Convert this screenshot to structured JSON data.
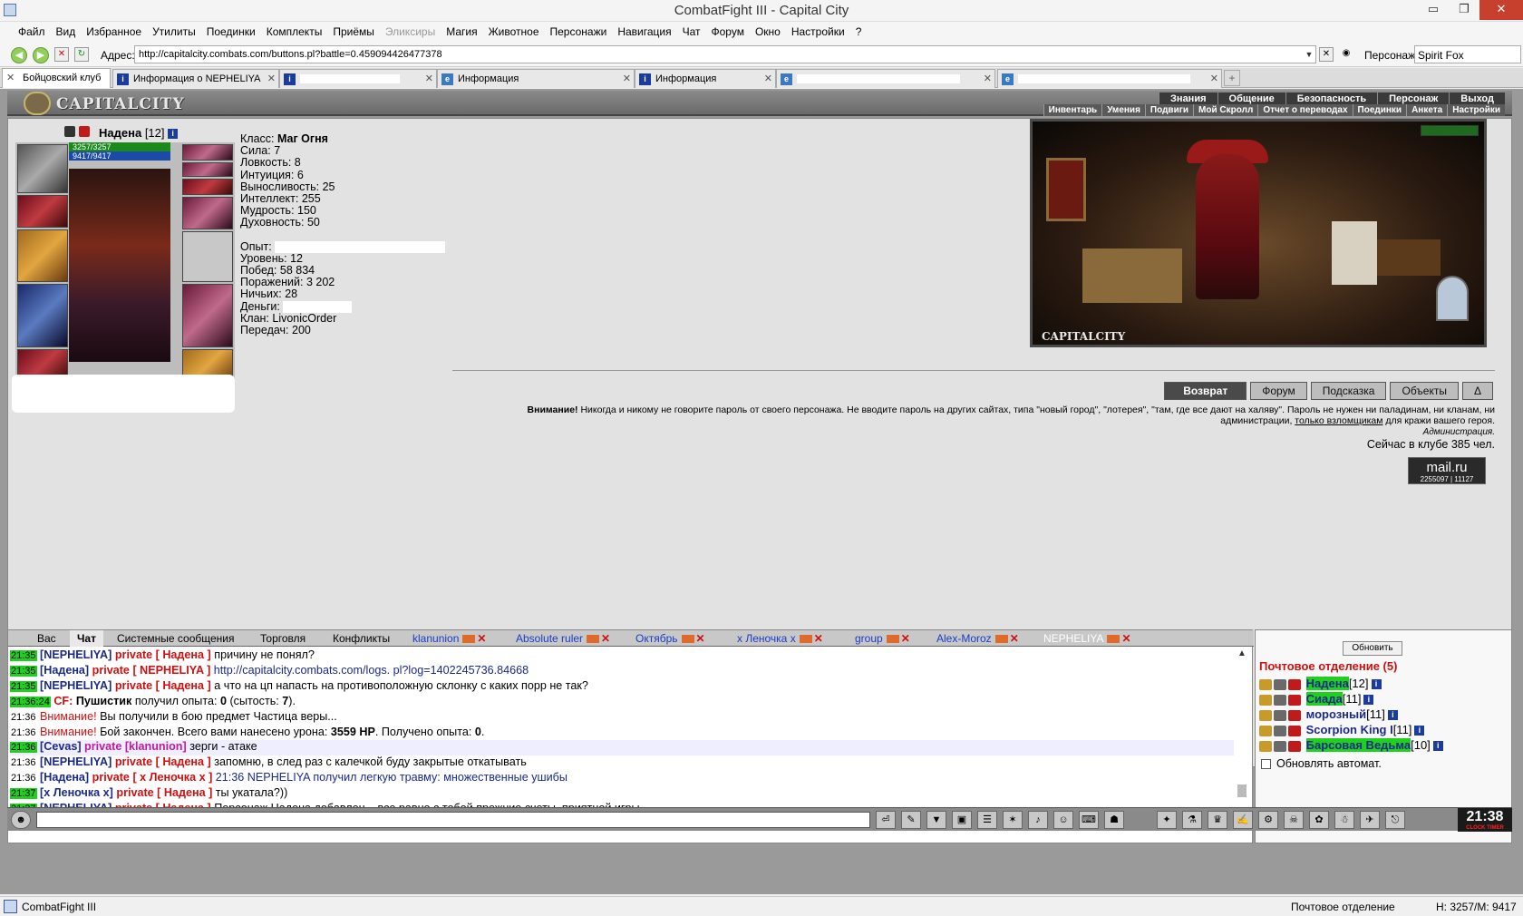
{
  "window": {
    "title": "CombatFight III - Capital City",
    "buttons": [
      "▭",
      "❐",
      "✕"
    ]
  },
  "menu": [
    "Файл",
    "Вид",
    "Избранное",
    "Утилиты",
    "Поединки",
    "Комплекты",
    "Приёмы",
    "Эликсиры",
    "Магия",
    "Животное",
    "Персонажи",
    "Навигация",
    "Чат",
    "Форум",
    "Окно",
    "Настройки",
    "?"
  ],
  "address": {
    "label": "Адрес:",
    "url": "http://capitalcity.combats.com/buttons.pl?battle=0.459094426477378"
  },
  "persona": {
    "label": "Персонаж:",
    "value": "Spirit Fox"
  },
  "tabs": [
    {
      "label": "Бойцовский клуб"
    },
    {
      "label": "Информация о NEPHELIYA"
    },
    {
      "label": ""
    },
    {
      "label": "Информация"
    },
    {
      "label": "Информация"
    },
    {
      "label": ""
    },
    {
      "label": ""
    }
  ],
  "game": {
    "logo": "CAPITALCITY",
    "nav_top": [
      "Знания",
      "Общение",
      "Безопасность",
      "Персонаж",
      "Выход"
    ],
    "nav_sub": [
      "Инвентарь",
      "Умения",
      "Подвиги",
      "Мой Скролл",
      "Отчет о переводах",
      "Поединки",
      "Анкета",
      "Настройки"
    ]
  },
  "character": {
    "name": "Надена",
    "level": "[12]",
    "hp": "3257/3257",
    "mp": "9417/9417",
    "stats": [
      {
        "label": "Класс: ",
        "value": "Маг Огня",
        "bold": true
      },
      {
        "label": "Сила: 7"
      },
      {
        "label": "Ловкость: 8"
      },
      {
        "label": "Интуиция: 6"
      },
      {
        "label": "Выносливость: 25"
      },
      {
        "label": "Интеллект: 255"
      },
      {
        "label": "Мудрость: 150"
      },
      {
        "label": "Духовность: 50"
      }
    ],
    "stats2": [
      "Опыт:",
      "Уровень: 12",
      "Побед: 58 834",
      "Поражений: 3 202",
      "Ничьих: 28",
      "Деньги:",
      "Клан: LivonicOrder",
      "Передач: 200"
    ]
  },
  "scene": {
    "caption": "CAPITALCITY"
  },
  "actions": [
    "Возврат",
    "Форум",
    "Подсказка",
    "Объекты",
    "Δ"
  ],
  "warning": {
    "bold": "Внимание!",
    "text": " Никогда и никому не говорите пароль от своего персонажа. Не вводите пароль на других сайтах, типа \"новый город\", \"лотерея\", \"там, где все дают на халяву\". Пароль не нужен ни паладинам, ни кланам, ни администрации, ",
    "link": "только взломщикам",
    "tail": " для кражи вашего героя."
  },
  "admin": "Администрация.",
  "online": "Сейчас в клубе 385 чел.",
  "mailru": {
    "brand": "mail.ru",
    "counts": "2255097 | 11127"
  },
  "chat_tabs": [
    "Вас",
    "Чат",
    "Системные сообщения",
    "Торговля",
    "Конфликты",
    "klanunion",
    "Absolute ruler",
    "Октябрь",
    "x Леночка x",
    "group",
    "Alex-Moroz",
    "NEPHELIYA"
  ],
  "chat": [
    {
      "t": "21:35",
      "who": "[NEPHELIYA]",
      "pv": "private [ Надена ]",
      "msg": "причину не понял?"
    },
    {
      "t": "21:35",
      "who": "[Надена]",
      "pv": "private [ NEPHELIYA ]",
      "msg": "http://capitalcity.combats.com/logs. pl?log=1402245736.84668"
    },
    {
      "t": "21:35",
      "who": "[NEPHELIYA]",
      "pv": "private [ Надена ]",
      "msg": "а что на цп напасть на противоположную склонку с каких порр не так?"
    },
    {
      "t": "21:36:24",
      "cf": "CF:",
      "b1": "Пушистик",
      "msg": " получил опыта: ",
      "n1": "0",
      "m2": " (сытость: ",
      "n2": "7",
      "m3": ")."
    },
    {
      "t": "21:36",
      "warn": "Внимание!",
      "msg": " Вы получили в бою предмет Частица веры..."
    },
    {
      "t": "21:36",
      "warn": "Внимание!",
      "msg": " Бой закончен. Всего вами нанесено урона: ",
      "n1": "3559 HP",
      "m2": ". Получено опыта: ",
      "n2": "0",
      "m3": "."
    },
    {
      "t": "21:36",
      "who": "[Cevas]",
      "pvp": "private [klanunion]",
      "msg": "зерги - атаке",
      "sel": true
    },
    {
      "t": "21:36",
      "who": "[NEPHELIYA]",
      "pv": "private [ Надена ]",
      "msg": "запомню, в след раз с калечкой буду закрытые откатывать"
    },
    {
      "t": "21:36",
      "who": "[Надена]",
      "pv": "private [ x Леночка x ]",
      "msgb": "21:36 NEPHELIYA получил легкую травму: множественные ушибы"
    },
    {
      "t": "21:37",
      "who": "[x Леночка x]",
      "pv": "private [ Надена ]",
      "msg": "ты укатала?))"
    },
    {
      "t": "21:37",
      "who": "[NEPHELIYA]",
      "pv": "private [ Надена ]",
      "msg": "Персонаж Надена добавлен. , все равно с тобой прежние счеты, приятной игры"
    }
  ],
  "mail": {
    "refresh": "Обновить",
    "title": "Почтовое отделение (5)",
    "users": [
      {
        "name": "Надена",
        "level": "[12]",
        "hl": true
      },
      {
        "name": "Сиада",
        "level": "[11]",
        "hl": true
      },
      {
        "name": "морозный",
        "level": "[11]",
        "hl": false
      },
      {
        "name": "Scorpion King I",
        "level": "[11]",
        "hl": false
      },
      {
        "name": "Барсовая Ведьма",
        "level": "[10]",
        "hl": true
      }
    ],
    "auto": "Обновлять автомат."
  },
  "clock": {
    "time": "21:38",
    "sub": "CLOCK TIMER"
  },
  "status": {
    "left": "CombatFight III",
    "mid": "Почтовое отделение",
    "right": "H: 3257/M: 9417"
  }
}
